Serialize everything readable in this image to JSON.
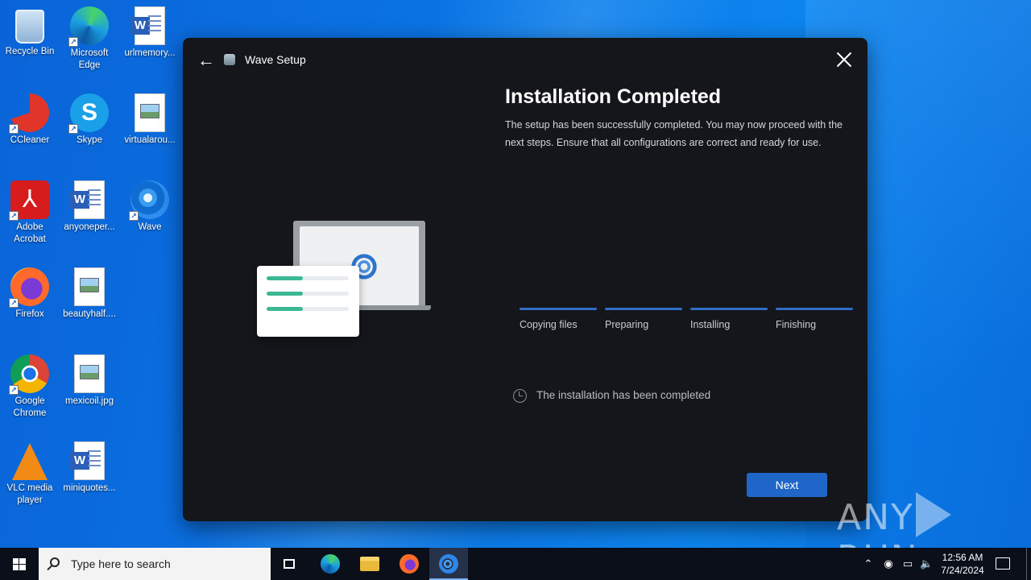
{
  "desktop": {
    "icons": [
      {
        "label": "Recycle Bin"
      },
      {
        "label": "Microsoft Edge"
      },
      {
        "label": "urlmemory..."
      },
      {
        "label": "CCleaner"
      },
      {
        "label": "Skype"
      },
      {
        "label": "virtualarou..."
      },
      {
        "label": "Adobe Acrobat"
      },
      {
        "label": "anyoneper..."
      },
      {
        "label": "Wave"
      },
      {
        "label": "Firefox"
      },
      {
        "label": "beautyhalf...."
      },
      {
        "label": "Google Chrome"
      },
      {
        "label": "mexicoil.jpg"
      },
      {
        "label": "VLC media player"
      },
      {
        "label": "miniquotes..."
      }
    ]
  },
  "installer": {
    "title": "Wave Setup",
    "heading": "Installation Completed",
    "description": "The setup has been successfully completed. You may now proceed with the next steps. Ensure that all configurations are correct and ready for use.",
    "steps": [
      {
        "label": "Copying files"
      },
      {
        "label": "Preparing"
      },
      {
        "label": "Installing"
      },
      {
        "label": "Finishing"
      }
    ],
    "status": "The installation has been completed",
    "next_label": "Next",
    "accent_color": "#1f66c8"
  },
  "watermark": {
    "left": "ANY",
    "right": "RUN"
  },
  "taskbar": {
    "search_placeholder": "Type here to search",
    "time": "12:56 AM",
    "date": "7/24/2024",
    "apps": [
      "task-view",
      "microsoft-edge",
      "file-explorer",
      "firefox",
      "wave"
    ]
  }
}
